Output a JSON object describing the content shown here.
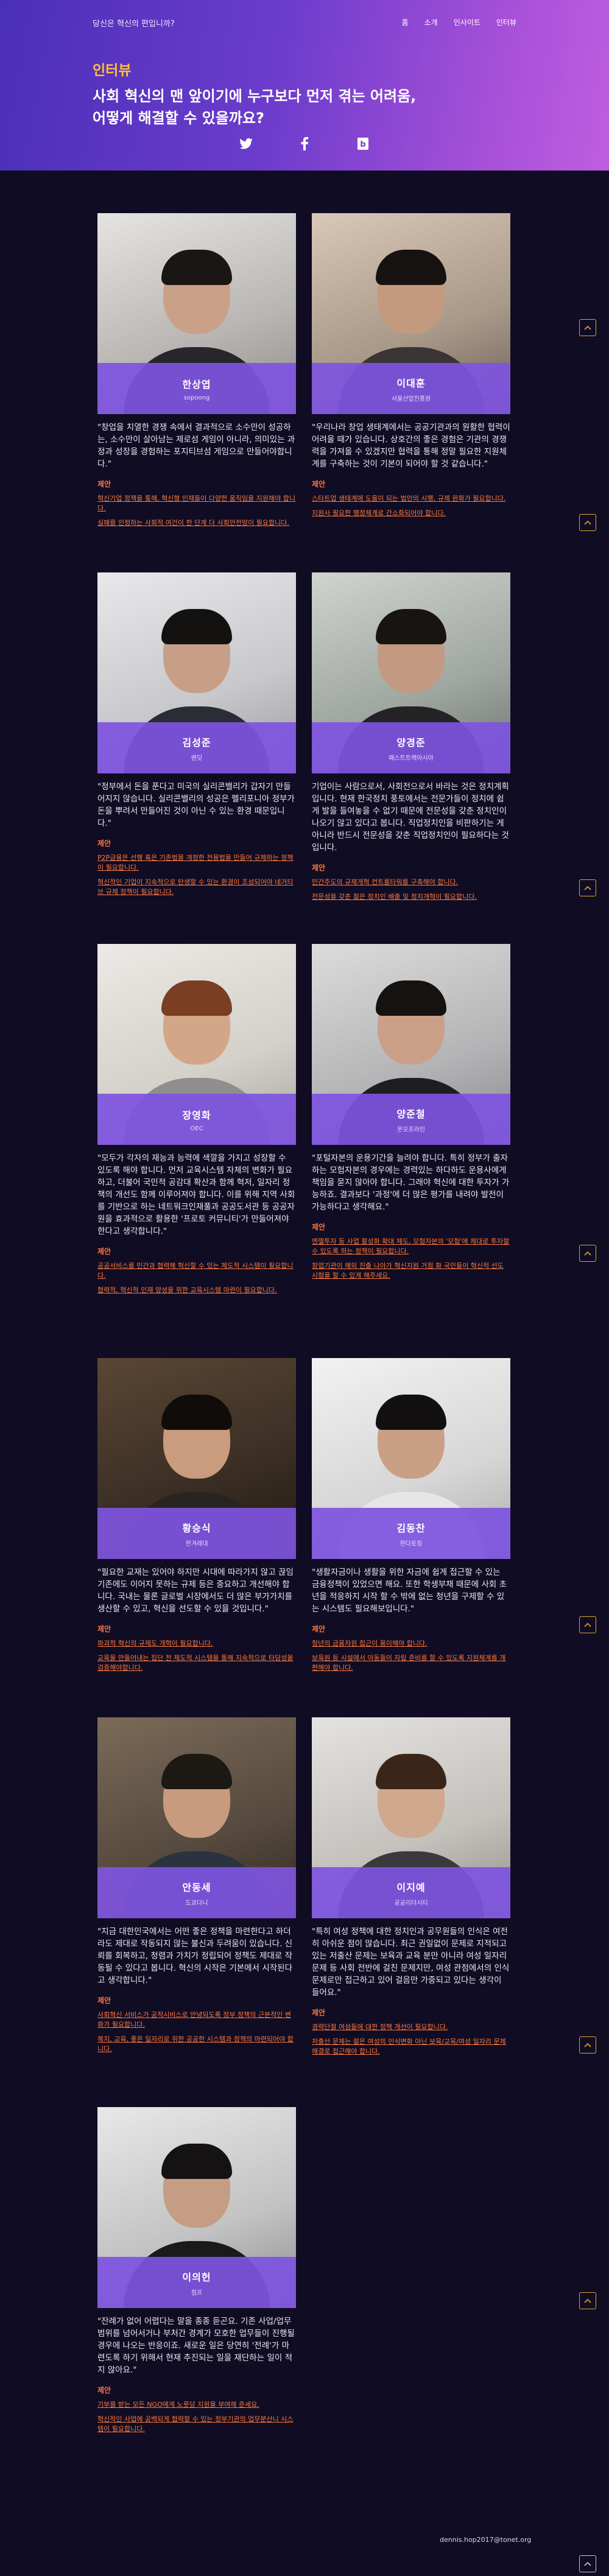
{
  "header": {
    "site_title": "당신은 혁신의 편입니까?",
    "nav": [
      "홈",
      "소개",
      "인사이트",
      "인터뷰"
    ],
    "section_label": "인터뷰",
    "headline_1": "사회 혁신의 맨 앞이기에 누구보다 먼저 겪는 어려움,",
    "headline_2": "어떻게 해결할 수 있을까요?"
  },
  "share": {
    "icons": [
      "twitter-icon",
      "facebook-icon",
      "bookmark-icon"
    ]
  },
  "proposal_label": "제안",
  "interviews": [
    {
      "name": "한상엽",
      "org": "sopoong",
      "quote": "\"창업을 치열한 경쟁 속에서 결과적으로 소수만이 성공하는, 소수만이 살아남는 제로섬 게임이 아니라, 의미있는 과정과 성장을 경험하는 포지티브섬 게임으로 만들어야합니다.\"",
      "proposals": [
        "혁신기업 정책을 통해, 혁신형 인재들이 다양한 움직임을 지원해야 합니다.",
        "실패를 인정하는 사회적 여건이 한 단계 더 사회안전망이 필요합니다."
      ]
    },
    {
      "name": "이대훈",
      "org": "서울산업진흥원",
      "quote": "\"우리나라 창업 생태계에서는 공공기관과의 원활한 협력이 어려울 때가 있습니다. 상호간의 좋은 경험은 기관의 경쟁력을 가져올 수 있겠지만 협력을 통해 정말 필요한 지원체계를 구축하는 것이 기본이 되어야 할 것 같습니다.\"",
      "proposals": [
        "스타트업 생태계에 도움이 되는 법안의 시행, 규제 완화가 필요합니다.",
        "지원사 필요한 행정체계로 간소화되어야 합니다."
      ]
    },
    {
      "name": "김성준",
      "org": "렌딧",
      "quote": "\"정부에서 돈을 푼다고 미국의 실리콘밸리가 갑자기 만들어지지 않습니다. 실리콘밸리의 성공은 펠리포니아 정부가 돈을 뿌려서 만들어진 것이 아닌 수 있는 환경 때문입니다.\"",
      "proposals": [
        "P2P금융은 선행 혹은 기존법을 개정한 전용법을 만들어 규제하는 정책이 필요합니다.",
        "혁신적인 기업이 지속적으로 탄생할 수 있는 환경이 조성되어야 네거티브 규제 정책이 필요합니다."
      ]
    },
    {
      "name": "양경준",
      "org": "패스트트랙아시아",
      "quote": "기업이는 사람으로서, 사회전으로서 바라는 것은 정치계획입니다. 현재 한국정치 풍토에서는 전문가들이 정치에 쉽게 발을 들여놓을 수 없기 때문에 전문성을 갖춘 정치인이 나오기 않고 있다고 봅니다. 직업정치인을 비판하기는 게 아니라 반드시 전문성을 갖춘 직업정치인이 필요하다는 것입니다.",
      "proposals": [
        "민간주도의 규제개혁 컨트롤타워를 구축해야 합니다.",
        "전문성을 갖춘 젊은 정치인 배출 및 정치개혁이 필요합니다."
      ]
    },
    {
      "name": "장영화",
      "org": "OEC",
      "quote": "\"모두가 각자의 재능과 능력에 색깔을 가지고 성장할 수 있도록 해야 합니다. 먼저 교육시스템 자체의 변화가 필요하고, 더불어 국민적 공감대 확산과 함께 혁저, 일자리 정책의 개선도 함께 이루어져야 합니다. 이를 위해 지역 사회를 기반으로 하는 네트워크인재풀과 공공도서관 등 공공자원을 효과적으로 활용한 '프로토 커뮤니티'가 만들어져야 한다고 생각합니다.\"",
      "proposals": [
        "공공서비스를 민간과 협력해 혁신할 수 있는 제도적 시스템이 필요합니다.",
        "협력적, 혁신적 인재 양성을 위한 교육시스템 마련이 필요합니다."
      ]
    },
    {
      "name": "양준철",
      "org": "온오프라인",
      "quote": "\"포털자본의 운용기간을 늘려야 합니다. 특히 정부가 출자하는 모험자본의 경우에는 경력있는 하다하도 운용사에게 책임을 묻지 않아야 합니다. 그래야 혁신에 대한 투자가 가능하죠. 결과보다 '과정'에 더 많은 평가를 내려야 발전이 가능하다고 생각해요.\"",
      "proposals": [
        "엔젤투자 등 사업 활성화 확대 제도, 모험자본의 '모험'에 제대로 투자할 수 있도록 하는 정책이 필요합니다.",
        "창업기관이 해외 진출 나아가 혁신지원 거점 화 국민들이 혁신적 선도 시험을 할 수 있게 해주세요."
      ]
    },
    {
      "name": "황승식",
      "org": "한겨레대",
      "quote": "\"필요한 교재는 있어야 하지만 시대에 따라가지 않고 끊임 기존에도 이어지 못하는 규제 등은 중요하고 개선해야 합니다. 국내는 물론 글로벌 시장에서도 더 많은 부가가치를 생산할 수 있고, 혁신을 선도할 수 있을 것입니다.\"",
      "proposals": [
        "파괴적 혁신의 규제도 개혁이 필요합니다.",
        "교육을 만들어내는 집단 전 제도적 시스템을 통해 지속적으로 타당성을 검증해야합니다."
      ]
    },
    {
      "name": "김동찬",
      "org": "한다토징",
      "quote": "\"생활자금이나 생활을 위한 자금에 쉽게 접근할 수 있는 금융정책이 있었으면 해요. 또한 학생부채 때문에 사회 초년을 적응하지 시작 할 수 밖에 없는 청년을 구제할 수 있는 시스템도 필요해보입니다.\"",
      "proposals": [
        "청년의 금융자원 접근이 용이해야 합니다.",
        "보육원 등 시설에서 아동들이 자립 준비를 할 수 있도록 지원체계를 개편해야 합니다."
      ]
    },
    {
      "name": "안동세",
      "org": "도쿄다니",
      "quote": "\"지금 대한민국에서는 어떤 좋은 정책을 마련한다고 하더라도 제대로 작동되지 않는 불신과 두려움이 있습니다. 신뢰를 회복하고, 청렴과 가치가 정립되어 정책도 제대로 작동될 수 있다고 봅니다. 혁신의 시작은 기본에서 시작된다고 생각합니다.\"",
      "proposals": [
        "사회혁신 서비스가 공적시비스로 안녕되도록 정부 정책의 근본적인 변화가 필요합니다.",
        "복지, 교육, 좋은 일자리로 위한 공공한 시스템과 정책의 마련되어야 합니다."
      ]
    },
    {
      "name": "이지예",
      "org": "공공리더시티",
      "quote": "\"특히 여성 정책에 대한 정치인과 공무원들의 인식은 여전히 아쉬운 점이 많습니다. 최근 권일없이 문제로 지적되고 있는 저출산 문제는 보육과 교육 분만 아니라 여성 일자리 문제 등 사회 전반에 걸친 문제지만, 여성 관점에서의 인식 문제로만 접근하고 있어 걸음만 가중되고 있다는 생각이 들어요.\"",
      "proposals": [
        "경력단절 여성들에 대한 정책 개선이 필요합니다.",
        "저출산 문제는 젊은 여성의 인식변화 아닌 보육/교육/여성 일자리 문제 해결로 접근해야 합니다."
      ]
    },
    {
      "name": "이의헌",
      "org": "점프",
      "quote": "\"잔례가 없어 어렵다는 말을 종종 듣곤요. 기존 사업/업무 범위를 넘어서거나 부처간 경계가 모호한 업무들이 진행될 경우에 나오는 반응이죠. 새로운 일은 당연히 '전례'가 마련도록 하기 위해서 현재 추진되는 일을 재단하는 일이 적지 않아요.\"",
      "proposals": [
        "기부를 받는 모든 NGO에게 노릇당 지원을 부여해 준세요.",
        "혁신적인 사업에 공백되게 협력할 수 있는 정부기관의 업무분산니 시스템이 필요합니다."
      ]
    }
  ],
  "footer": {
    "email": "dennis.hop2017@tonet.org"
  }
}
